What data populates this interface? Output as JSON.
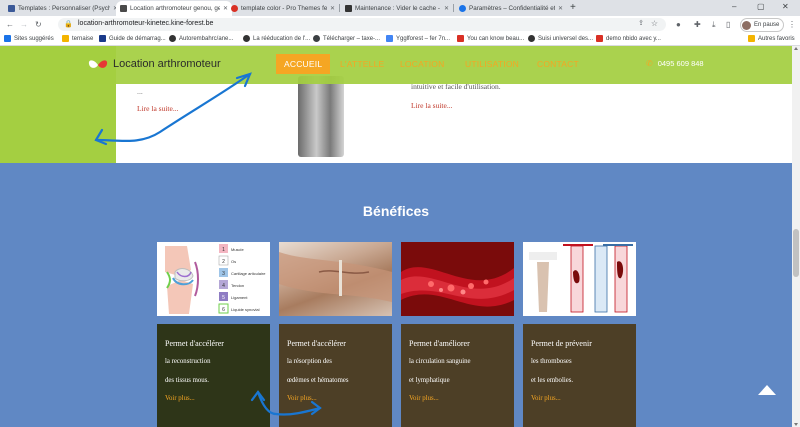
{
  "browser": {
    "tabs": [
      {
        "title": "Templates : Personnaliser (Psych...",
        "icon_color": "#3b5998",
        "active": false
      },
      {
        "title": "Location arthromoteur genou, ge...",
        "icon_color": "#4a4a4a",
        "active": true
      },
      {
        "title": "template color - Pro Themes fee...",
        "icon_color": "#d93025",
        "active": false
      },
      {
        "title": "Maintenance : Vider le cache - ...",
        "icon_color": "#333333",
        "active": false
      },
      {
        "title": "Paramètres – Confidentialité et sé...",
        "icon_color": "#1a73e8",
        "active": false
      }
    ],
    "url": "location-arthromoteur-kinetec.kine-forest.be",
    "profile_label": "En pause",
    "bookmarks": [
      {
        "label": "Sites suggérés",
        "icon_color": "#1a73e8"
      },
      {
        "label": "ternaise",
        "icon_color": "#f4b400"
      },
      {
        "label": "Guide de démarrag...",
        "icon_color": "#1a3a8a"
      },
      {
        "label": "Autorembahrc/ane...",
        "icon_color": "#333333"
      },
      {
        "label": "La rééducation de l'...",
        "icon_color": "#333333"
      },
      {
        "label": "Télécharger – taxe-...",
        "icon_color": "#3c4043"
      },
      {
        "label": "Ygglforest – fer 7n...",
        "icon_color": "#4285f4"
      },
      {
        "label": "You can know beau...",
        "icon_color": "#d93025"
      },
      {
        "label": "Suisi universel des...",
        "icon_color": "#333333"
      },
      {
        "label": "demo nbido avec y...",
        "icon_color": "#d93025"
      }
    ],
    "other_bookmarks": "Autres favoris"
  },
  "site": {
    "brand": "Location arthromoteur",
    "menu": [
      {
        "label": "ACCUEIL",
        "active": true
      },
      {
        "label": "L'ATTELLE",
        "active": false
      },
      {
        "label": "LOCATION",
        "active": false
      },
      {
        "label": "UTILISATION",
        "active": false
      },
      {
        "label": "CONTACT",
        "active": false
      }
    ],
    "phone": "0495 609 848",
    "accent_color": "#f5a623",
    "header_color": "#a4cf41"
  },
  "hero": {
    "intro_2": "intuitive et facile d'utilisation.",
    "dots": "...",
    "read_more": "Lire la suite..."
  },
  "benefits": {
    "title": "Bénéfices",
    "bg_color": "#6088c4",
    "knee_legend": [
      "Muscle",
      "Os",
      "Cartilage articulaire",
      "Tendon",
      "Ligament",
      "Liquide synovial"
    ],
    "cards": [
      {
        "heading": "Permet d'accélérer",
        "line1": "la reconstruction",
        "line2": "des tissus mous.",
        "more": "Voir plus...",
        "box_color": "#2e3518"
      },
      {
        "heading": "Permet d'accélérer",
        "line1": "la résorption des",
        "line2": "œdèmes et hématomes",
        "more": "Voir plus...",
        "box_color": "#4d3f26"
      },
      {
        "heading": "Permet d'améliorer",
        "line1": "la circulation sanguine",
        "line2": "et lymphatique",
        "more": "Voir plus...",
        "box_color": "#4d3f26"
      },
      {
        "heading": "Permet de prévenir",
        "line1": "les thromboses",
        "line2": "et les embolies.",
        "more": "Voir plus...",
        "box_color": "#4d3f26"
      }
    ]
  }
}
